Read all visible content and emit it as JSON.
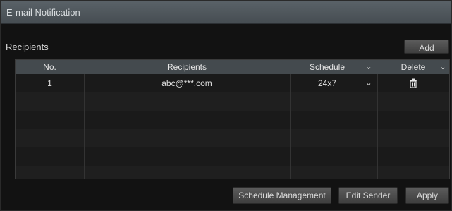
{
  "window": {
    "title": "E-mail Notification"
  },
  "section": {
    "label": "Recipients"
  },
  "buttons": {
    "add": "Add",
    "schedule_management": "Schedule Management",
    "edit_sender": "Edit Sender",
    "apply": "Apply"
  },
  "table": {
    "headers": {
      "no": "No.",
      "recipients": "Recipients",
      "schedule": "Schedule",
      "delete": "Delete"
    },
    "rows": [
      {
        "no": "1",
        "recipient": "abc@***.com",
        "schedule": "24x7"
      }
    ]
  },
  "icons": {
    "dropdown": "chevron-down-icon",
    "delete": "trash-icon"
  }
}
